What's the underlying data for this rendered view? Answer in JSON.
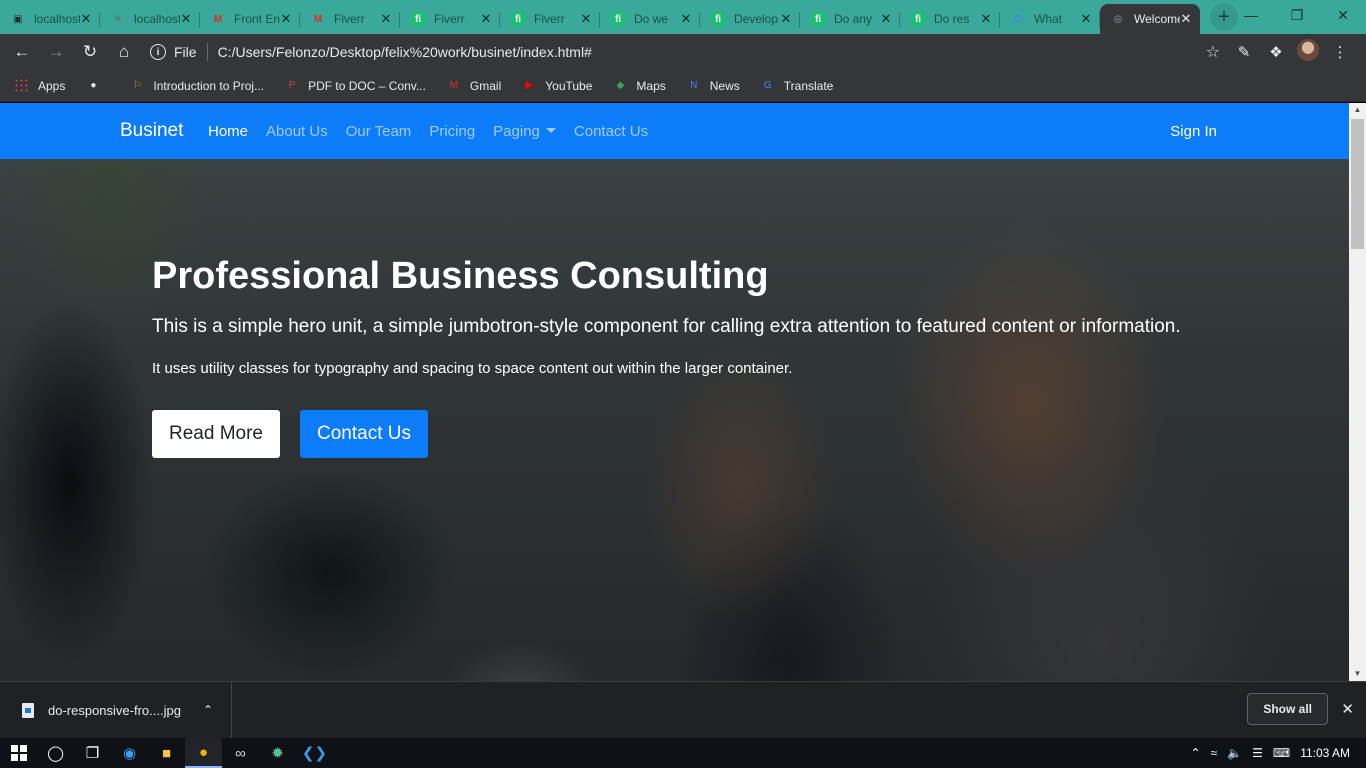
{
  "browser": {
    "tabs": [
      {
        "title": "localhost",
        "icon": "cube-icon",
        "color": "#2c2c2c"
      },
      {
        "title": "localhost",
        "icon": "atom-icon",
        "color": "#6b6b6b"
      },
      {
        "title": "Front End",
        "icon": "gmail-icon",
        "color": "#d93025"
      },
      {
        "title": "Fiverr",
        "icon": "gmail-icon",
        "color": "#d93025"
      },
      {
        "title": "Fiverr",
        "icon": "fiverr-icon",
        "color": "#1dbf73"
      },
      {
        "title": "Fiverr",
        "icon": "fiverr-icon",
        "color": "#1dbf73"
      },
      {
        "title": "Do we",
        "icon": "fiverr-icon",
        "color": "#1dbf73"
      },
      {
        "title": "Develop",
        "icon": "fiverr-icon",
        "color": "#1dbf73"
      },
      {
        "title": "Do any",
        "icon": "fiverr-icon",
        "color": "#1dbf73"
      },
      {
        "title": "Do res",
        "icon": "fiverr-icon",
        "color": "#1dbf73"
      },
      {
        "title": "What",
        "icon": "google-icon",
        "color": "#4285f4"
      },
      {
        "title": "Welcome",
        "icon": "globe-icon",
        "color": "#9aa0a6",
        "active": true
      }
    ],
    "address": {
      "scheme_label": "File",
      "url": "C:/Users/Felonzo/Desktop/felix%20work/businet/index.html#"
    },
    "bookmarks": [
      {
        "label": "Apps",
        "icon": "apps-grid-icon"
      },
      {
        "label": "",
        "icon": "globe-icon"
      },
      {
        "label": "Introduction to Proj...",
        "icon": "bookmark-icon"
      },
      {
        "label": "PDF to DOC – Conv...",
        "icon": "pdf-icon"
      },
      {
        "label": "Gmail",
        "icon": "gmail-icon"
      },
      {
        "label": "YouTube",
        "icon": "youtube-icon"
      },
      {
        "label": "Maps",
        "icon": "maps-icon"
      },
      {
        "label": "News",
        "icon": "news-icon"
      },
      {
        "label": "Translate",
        "icon": "translate-icon"
      }
    ]
  },
  "page": {
    "brand": "Businet",
    "nav": [
      {
        "label": "Home",
        "active": true
      },
      {
        "label": "About Us"
      },
      {
        "label": "Our Team"
      },
      {
        "label": "Pricing"
      },
      {
        "label": "Paging",
        "dropdown": true
      },
      {
        "label": "Contact Us"
      }
    ],
    "sign_in": "Sign In",
    "hero": {
      "title": "Professional Business Consulting",
      "lead": "This is a simple hero unit, a simple jumbotron-style component for calling extra attention to featured content or information.",
      "sub": "It uses utility classes for typography and spacing to space content out within the larger container.",
      "read_more": "Read More",
      "contact": "Contact Us"
    },
    "accent_color": "#0d7cf8"
  },
  "downloads": {
    "file": "do-responsive-fro....jpg",
    "show_all": "Show all"
  },
  "taskbar": {
    "time": "11:03 AM"
  }
}
